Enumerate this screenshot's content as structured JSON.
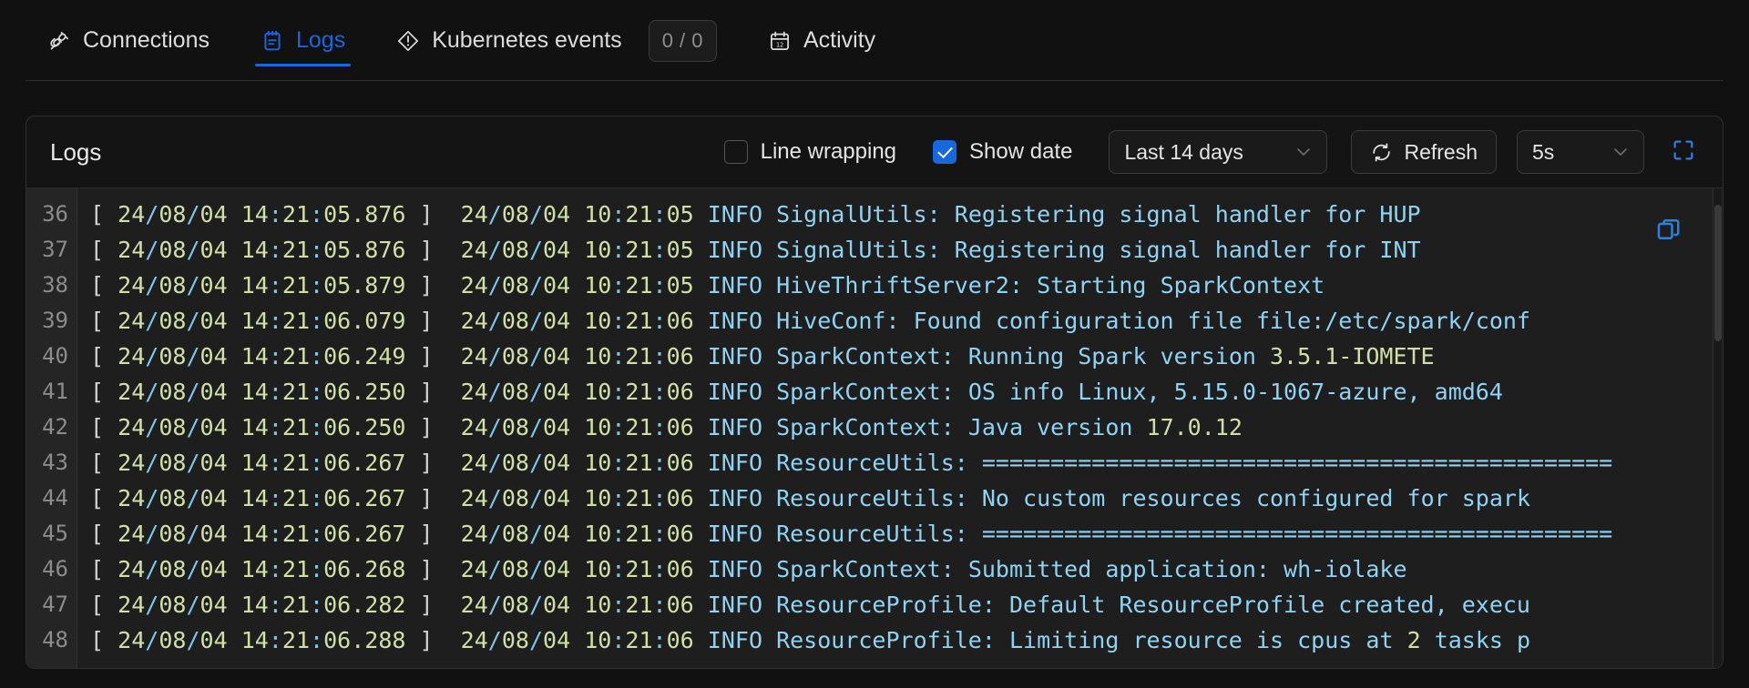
{
  "colors": {
    "accent": "#1668dc",
    "page_bg": "#111111",
    "card_bg": "#141414",
    "viewer_bg": "#1e1e1e",
    "log_date": "#cfe0a6",
    "log_sep": "#7ec6ea",
    "log_message": "#8fd3f4",
    "bracket": "#d4d4d4",
    "copy_icon": "#2f7fe0"
  },
  "tabs": [
    {
      "id": "connections",
      "label": "Connections",
      "icon": "plug-icon",
      "active": false,
      "badge": null
    },
    {
      "id": "logs",
      "label": "Logs",
      "icon": "notepad-icon",
      "active": true,
      "badge": null
    },
    {
      "id": "kubernetes-events",
      "label": "Kubernetes events",
      "icon": "alert-diamond-icon",
      "active": false,
      "badge": "0 / 0"
    },
    {
      "id": "activity",
      "label": "Activity",
      "icon": "calendar-icon",
      "active": false,
      "badge": null
    }
  ],
  "panel": {
    "title": "Logs",
    "line_wrapping": {
      "label": "Line wrapping",
      "checked": false
    },
    "show_date": {
      "label": "Show date",
      "checked": true
    },
    "time_range": {
      "value": "Last 14 days",
      "chevron": "chevron-down-icon"
    },
    "refresh": {
      "label": "Refresh",
      "icon": "refresh-icon"
    },
    "interval": {
      "value": "5s",
      "chevron": "chevron-down-icon"
    },
    "fullscreen": {
      "icon": "expand-icon"
    },
    "copy": {
      "icon": "copy-icon"
    }
  },
  "log": {
    "lines": [
      {
        "n": "36",
        "ts": "24/08/04 14:21:05.876",
        "date": "24/08/04 10:21:05",
        "msg": "INFO SignalUtils: Registering signal handler for HUP"
      },
      {
        "n": "37",
        "ts": "24/08/04 14:21:05.876",
        "date": "24/08/04 10:21:05",
        "msg": "INFO SignalUtils: Registering signal handler for INT"
      },
      {
        "n": "38",
        "ts": "24/08/04 14:21:05.879",
        "date": "24/08/04 10:21:05",
        "msg": "INFO HiveThriftServer2: Starting SparkContext"
      },
      {
        "n": "39",
        "ts": "24/08/04 14:21:06.079",
        "date": "24/08/04 10:21:06",
        "msg": "INFO HiveConf: Found configuration file file:/etc/spark/conf"
      },
      {
        "n": "40",
        "ts": "24/08/04 14:21:06.249",
        "date": "24/08/04 10:21:06",
        "msg": "INFO SparkContext: Running Spark version 3.5.1-IOMETE"
      },
      {
        "n": "41",
        "ts": "24/08/04 14:21:06.250",
        "date": "24/08/04 10:21:06",
        "msg": "INFO SparkContext: OS info Linux, 5.15.0-1067-azure, amd64"
      },
      {
        "n": "42",
        "ts": "24/08/04 14:21:06.250",
        "date": "24/08/04 10:21:06",
        "msg": "INFO SparkContext: Java version 17.0.12"
      },
      {
        "n": "43",
        "ts": "24/08/04 14:21:06.267",
        "date": "24/08/04 10:21:06",
        "msg": "INFO ResourceUtils: =============================================="
      },
      {
        "n": "44",
        "ts": "24/08/04 14:21:06.267",
        "date": "24/08/04 10:21:06",
        "msg": "INFO ResourceUtils: No custom resources configured for spark"
      },
      {
        "n": "45",
        "ts": "24/08/04 14:21:06.267",
        "date": "24/08/04 10:21:06",
        "msg": "INFO ResourceUtils: =============================================="
      },
      {
        "n": "46",
        "ts": "24/08/04 14:21:06.268",
        "date": "24/08/04 10:21:06",
        "msg": "INFO SparkContext: Submitted application: wh-iolake"
      },
      {
        "n": "47",
        "ts": "24/08/04 14:21:06.282",
        "date": "24/08/04 10:21:06",
        "msg": "INFO ResourceProfile: Default ResourceProfile created, execu"
      },
      {
        "n": "48",
        "ts": "24/08/04 14:21:06.288",
        "date": "24/08/04 10:21:06",
        "msg": "INFO ResourceProfile: Limiting resource is cpus at 2 tasks p"
      }
    ]
  }
}
